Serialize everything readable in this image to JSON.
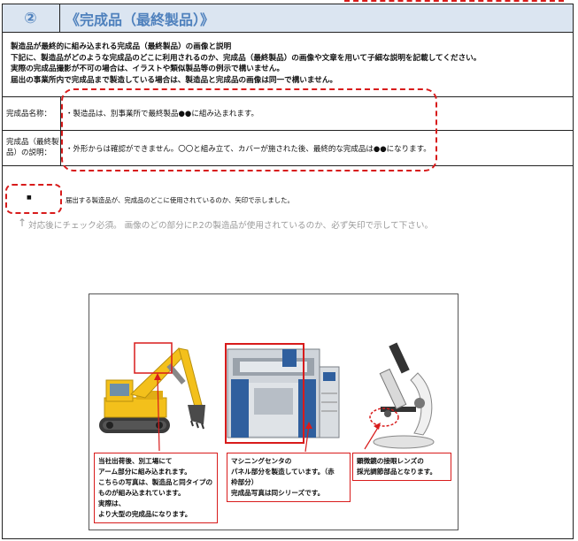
{
  "header": {
    "number": "②",
    "title": "《完成品（最終製品）》"
  },
  "intro_lines": [
    "製造品が最終的に組み込まれる完成品（最終製品）の画像と説明",
    "下記に、製造品がどのような完成品のどこに利用されるのか、完成品（最終製品）の画像や文章を用いて子細な説明を記載してください。",
    "実際の完成品撮影が不可の場合は、イラストや類似製品等の例示で構いません。",
    "届出の事業所内で完成品まで製造している場合は、製造品と完成品の画像は同一で構いません。"
  ],
  "rows": [
    {
      "label": "完成品名称：",
      "value": "・製造品は、別事業所で最終製品●●に組み込まれます。"
    },
    {
      "label_lines": [
        "完成品（最終製",
        "品）の説明："
      ],
      "value": "・外形からは確認ができません。〇〇と組み立て、カバーが施された後、最終的な完成品は●●になります。"
    }
  ],
  "marker": "■",
  "arrow_note": "届出する製造品が、完成品のどこに使用されているのか、矢印で示しました。",
  "check_note_arrow": "↑",
  "check_note": "対応後にチェック必須。 画像のどの部分にP.2の製造品が使用されているのか、必ず矢印で示して下さい。",
  "captions": {
    "excavator": [
      "当社出荷後、別工場にて",
      "アーム部分に組み込まれます。",
      "こちらの写真は、製造品と同タイプの",
      "ものが組み込まれています。",
      "実際は、",
      "より大型の完成品になります。"
    ],
    "machining": [
      "マシニングセンタの",
      "パネル部分を製造しています。（赤",
      "枠部分）",
      "完成品写真は同シリーズです。"
    ],
    "microscope": [
      "顕微鏡の接眼レンズの",
      "採光調節部品となります。"
    ]
  },
  "colors": {
    "header_bg": "#dbe5f1",
    "header_text": "#4f81bd",
    "annotation_red": "#d81b1b",
    "excavator_yellow": "#f3c01b",
    "machine_blue": "#2f5f9e"
  }
}
